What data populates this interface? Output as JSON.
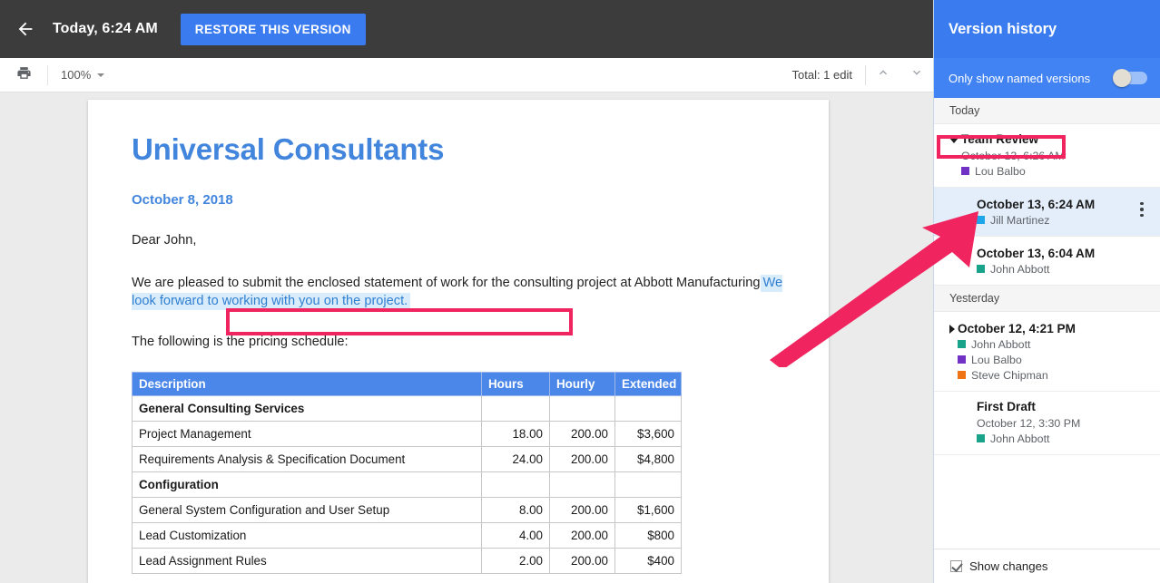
{
  "topbar": {
    "back_icon": "arrow-left-icon",
    "version_time": "Today, 6:24 AM",
    "restore_label": "RESTORE THIS VERSION"
  },
  "toolbar": {
    "print_icon": "print-icon",
    "zoom_level": "100%",
    "zoom_caret_icon": "chevron-down-icon",
    "total_edits": "Total: 1 edit",
    "prev_icon": "chevron-up-icon",
    "next_icon": "chevron-down-icon"
  },
  "document": {
    "title": "Universal Consultants",
    "date": "October 8, 2018",
    "salutation": "Dear John,",
    "body_before_highlight": "We are pleased to submit the enclosed statement of work for the consulting project at Abbott Manufacturing",
    "highlighted_text": "We look forward to working with you on the project.",
    "body_after": "The following is the pricing schedule:",
    "table": {
      "headers": [
        "Description",
        "Hours",
        "Hourly",
        "Extended"
      ],
      "rows": [
        {
          "type": "group",
          "description": "General Consulting Services",
          "hours": "",
          "hourly": "",
          "extended": ""
        },
        {
          "type": "item",
          "description": "Project Management",
          "hours": "18.00",
          "hourly": "200.00",
          "extended": "$3,600"
        },
        {
          "type": "item",
          "description": "Requirements Analysis & Specification Document",
          "hours": "24.00",
          "hourly": "200.00",
          "extended": "$4,800"
        },
        {
          "type": "group",
          "description": "Configuration",
          "hours": "",
          "hourly": "",
          "extended": ""
        },
        {
          "type": "item",
          "description": "General System Configuration and User Setup",
          "hours": "8.00",
          "hourly": "200.00",
          "extended": "$1,600"
        },
        {
          "type": "item",
          "description": "Lead Customization",
          "hours": "4.00",
          "hourly": "200.00",
          "extended": "$800"
        },
        {
          "type": "item",
          "description": "Lead Assignment Rules",
          "hours": "2.00",
          "hourly": "200.00",
          "extended": "$400"
        }
      ]
    }
  },
  "sidebar": {
    "title": "Version history",
    "toggle_label": "Only show named versions",
    "toggle_state": "off",
    "groups": [
      {
        "label": "Today",
        "versions": [
          {
            "name": "Team Review",
            "timestamp": "October 13, 6:26 AM",
            "expander": "down",
            "selected": false,
            "kebab": false,
            "editors": [
              {
                "name": "Lou Balbo",
                "color": "#7131c4"
              }
            ]
          },
          {
            "name": "",
            "timestamp": "October 13, 6:24 AM",
            "expander": "none",
            "selected": true,
            "kebab": true,
            "editors": [
              {
                "name": "Jill Martinez",
                "color": "#1fa6ea"
              }
            ]
          },
          {
            "name": "",
            "timestamp": "October 13, 6:04 AM",
            "expander": "none",
            "selected": false,
            "kebab": false,
            "editors": [
              {
                "name": "John Abbott",
                "color": "#19a38a"
              }
            ]
          }
        ]
      },
      {
        "label": "Yesterday",
        "versions": [
          {
            "name": "",
            "timestamp": "October 12, 4:21 PM",
            "expander": "right",
            "selected": false,
            "kebab": false,
            "editors": [
              {
                "name": "John Abbott",
                "color": "#19a38a"
              },
              {
                "name": "Lou Balbo",
                "color": "#7131c4"
              },
              {
                "name": "Steve Chipman",
                "color": "#ef7215"
              }
            ]
          },
          {
            "name": "First Draft",
            "timestamp": "October 12, 3:30 PM",
            "expander": "none",
            "selected": false,
            "kebab": false,
            "editors": [
              {
                "name": "John Abbott",
                "color": "#19a38a"
              }
            ]
          }
        ]
      }
    ],
    "footer": {
      "show_changes_label": "Show changes",
      "show_changes_checked": true
    }
  },
  "annotations": {
    "highlight_box_color": "#f0245f",
    "team_review_box_color": "#f0245f",
    "arrow_color": "#f0245f"
  },
  "colors": {
    "accent_blue": "#3a7cf0",
    "topbar_dark": "#3c3c3c",
    "doc_heading_blue": "#4285dd",
    "table_header_blue": "#4a87e8",
    "selection_blue": "#e4eefb",
    "annotation_pink": "#f0245f"
  }
}
